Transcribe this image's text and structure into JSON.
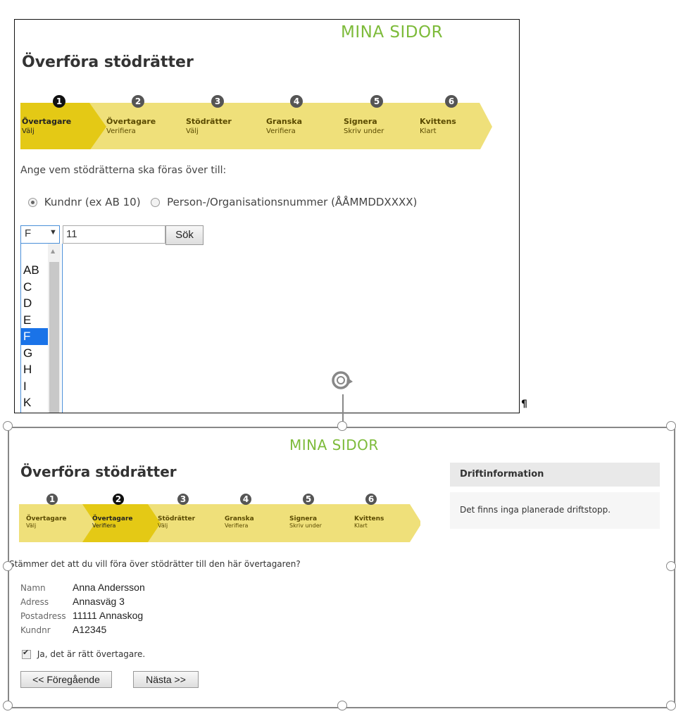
{
  "shot1": {
    "brand": "MINA SIDOR",
    "title": "Överföra stödrätter",
    "steps": [
      {
        "num": "1",
        "label": "Övertagare",
        "sub": "Välj"
      },
      {
        "num": "2",
        "label": "Övertagare",
        "sub": "Verifiera"
      },
      {
        "num": "3",
        "label": "Stödrätter",
        "sub": "Välj"
      },
      {
        "num": "4",
        "label": "Granska",
        "sub": "Verifiera"
      },
      {
        "num": "5",
        "label": "Signera",
        "sub": "Skriv under"
      },
      {
        "num": "6",
        "label": "Kvittens",
        "sub": "Klart"
      }
    ],
    "active_step": 1,
    "prompt": "Ange vem stödrätterna ska föras över till:",
    "radio_kundnr": "Kundnr (ex AB 10)",
    "radio_person": "Person-/Organisationsnummer (ÅÅMMDDXXXX)",
    "prefix_select": "F",
    "number_input": "11",
    "search_button": "Sök",
    "options": [
      "AB",
      "C",
      "D",
      "E",
      "F",
      "G",
      "H",
      "I",
      "K"
    ],
    "selected_option": "F"
  },
  "pilcrow": "¶",
  "shot2": {
    "brand": "MINA SIDOR",
    "title": "Överföra stödrätter",
    "steps": [
      {
        "num": "1",
        "label": "Övertagare",
        "sub": "Välj"
      },
      {
        "num": "2",
        "label": "Övertagare",
        "sub": "Verifiera"
      },
      {
        "num": "3",
        "label": "Stödrätter",
        "sub": "Välj"
      },
      {
        "num": "4",
        "label": "Granska",
        "sub": "Verifiera"
      },
      {
        "num": "5",
        "label": "Signera",
        "sub": "Skriv under"
      },
      {
        "num": "6",
        "label": "Kvittens",
        "sub": "Klart"
      }
    ],
    "active_step": 2,
    "question": "Stämmer det att du vill föra över stödrätter till den här övertagaren?",
    "info": [
      {
        "label": "Namn",
        "value": "Anna Andersson"
      },
      {
        "label": "Adress",
        "value": "Annasväg 3"
      },
      {
        "label": "Postadress",
        "value": "11111 Annaskog"
      },
      {
        "label": "Kundnr",
        "value": "A12345"
      }
    ],
    "confirm_checkbox": "Ja, det är rätt övertagare.",
    "prev_button": "<< Föregående",
    "next_button": "Nästa >>",
    "drift_title": "Driftinformation",
    "drift_text": "Det finns inga planerade driftstopp."
  },
  "colors": {
    "brand": "#7dbb3a",
    "step_bg": "#efe07a",
    "step_active": "#e4c915",
    "selected_option": "#1a73e8"
  }
}
